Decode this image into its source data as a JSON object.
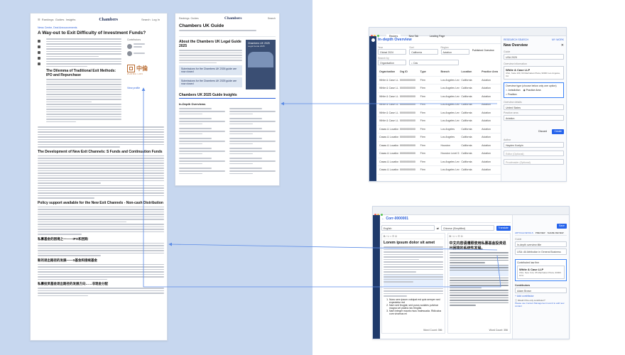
{
  "article": {
    "nav_breadcrumb": "News Centre, Deal Announcements",
    "title": "A Way-out to Exit Difficulty of Investment Funds?",
    "section1": "The Dilemma of Traditional Exit Methods: IPO and Repurchase",
    "section2": "The Development of New Exit Channels: S Funds and Continuation Funds",
    "section3": "Policy support available for the New Exit Channels - Non-cash Distribution",
    "cn1": "私募基金的困境之一——IPO和回购",
    "cn2": "新的退出路径的发展——S基金和接续基金",
    "cn3": "私募投资基金退出路径的发展方向……非现金分配",
    "firm_logo_cn": "中倫",
    "firm_logo_en": "ZHONG LUN",
    "view_profile": "View profile"
  },
  "guide": {
    "brand": "Chambers",
    "brand_sub": "and partners",
    "title": "Chambers UK Guide",
    "about": "About the Chambers UK Legal Guide 2025",
    "sub1": "Submissions for the Chambers UK 2026 guide are now closed",
    "sub2": "Submissions for the Chambers UK 2025 guide are now closed",
    "insights": "Chambers UK 2025 Guide Insights",
    "indepth": "In-Depth Overviews",
    "book_title": "Chambers UK 2025",
    "book_sub": "Legal Guide 2025"
  },
  "overview_app": {
    "tab1": "Reuters",
    "tab2": "New Tab",
    "tab3": "Landing Page",
    "title": "In-depth Overview",
    "nav1": "RESEARCH SEARCH",
    "nav2": "MY WORK",
    "filters": [
      {
        "label": "Year",
        "value": "Global 2024"
      },
      {
        "label": "Sort",
        "value": "California"
      },
      {
        "label": "Region",
        "value": "Aviation"
      }
    ],
    "published_label": "Published Overview",
    "search_by": "Search by",
    "search_by_value": "Organisation",
    "search_value": "Cas",
    "columns": [
      "Organisation",
      "Org ID",
      "Type",
      "Branch",
      "Location",
      "Practice Area"
    ],
    "rows": [
      [
        "White & Case LLP",
        "00000000000",
        "Firm",
        "Los Angeles Level 3",
        "California",
        "Aviation"
      ],
      [
        "White & Case LLP",
        "00000000000",
        "Firm",
        "Los Angeles Level 3",
        "California",
        "Aviation"
      ],
      [
        "White & Case LLP",
        "00000000000",
        "Firm",
        "Los Angeles Level 3",
        "California",
        "Aviation"
      ],
      [
        "White & Case LLP",
        "00000000000",
        "Firm",
        "Los Angeles Level 3",
        "California",
        "Aviation"
      ],
      [
        "White & Case LLP",
        "00000000000",
        "Firm",
        "Los Angeles Level 3",
        "California",
        "Aviation"
      ],
      [
        "White & Case LLP",
        "00000000000",
        "Firm",
        "Los Angeles Level 3",
        "California",
        "Aviation"
      ],
      [
        "Casas & Locations",
        "00000000000",
        "Firm",
        "Los Angeles",
        "California",
        "Aviation"
      ],
      [
        "Casas & Locations",
        "00000000000",
        "Firm",
        "Los Angeles",
        "California",
        "Aviation"
      ],
      [
        "Casas & Locations",
        "00000000000",
        "Firm",
        "Houston",
        "California",
        "Aviation"
      ],
      [
        "Casas & Locations",
        "00000000000",
        "Firm",
        "Houston Level 5",
        "California",
        "Aviation"
      ],
      [
        "Casas & Locations",
        "00000000000",
        "Firm",
        "Los Angeles Level 3",
        "California",
        "Aviation"
      ],
      [
        "Casas & Locations",
        "00000000000",
        "Firm",
        "Los Angeles Level 3",
        "California",
        "Aviation"
      ]
    ],
    "panel": {
      "title": "New Overview",
      "guide_label": "Guide",
      "guide_value": "USA 2025",
      "org_label": "Overview information",
      "org_name": "White & Case LLP",
      "org_addr": "USA, Suite 100, 90 Manhattan Plaza, 90000 Los Angeles, CA",
      "type_label": "Overview type (choose below only one option)",
      "opt1": "Jurisdiction",
      "opt2": "Practice Area",
      "opt3": "Position",
      "loc_label": "Overview details",
      "loc_value": "United States",
      "practice_label": "Practice area",
      "practice_value": "Aviation",
      "discard": "Discard",
      "create": "Create",
      "author_label": "Author",
      "author_value": "Hayden Koelpin",
      "editor_label": "Editor (Optional)",
      "reviewer_label": "Proofreader (Optional)"
    }
  },
  "editor_app": {
    "title": "Corr-0000001",
    "lang_left": "English",
    "lang_right": "Chinese (Simplified)",
    "translate": "Translate",
    "save": "Save",
    "heading_en": "Lorem ipsum dolor sit amet",
    "heading_cn": "中文内容请遵照使用私募基金投资退出困境的系统性发展。",
    "list_items": [
      "Nunc sem ipsum volutpat est quis semper sed expectetur est",
      "Nam sed feugiat, sed purus sodales pulvinar magna vel platea nec fringilla",
      "Nam integer mauris risus malesuada. Ridiculus cum vivamus mi"
    ],
    "word_count_left": "Word Count: 356",
    "word_count_right": "Word Count: 356",
    "side_tabs": [
      "ARTICLE DETAILS",
      "PREVIEW",
      "SHARE REVIEW"
    ],
    "side_guide_label": "Guide",
    "side_guide": "In-depth overview title",
    "side_guide_sub": "USA: All Attribution in General Business",
    "side_linked": "Contributed law firm",
    "side_firm": "White & Case LLP",
    "side_firm_addr": "USA, New York, 95 Manhattan Plaza, 90000 NYC",
    "side_contributors": "Contributors",
    "side_author": "Adam Brown",
    "side_add": "Add contributor",
    "side_note": "Would if the only contributor?",
    "side_note2": "Please use Content Management record to add new contact"
  }
}
